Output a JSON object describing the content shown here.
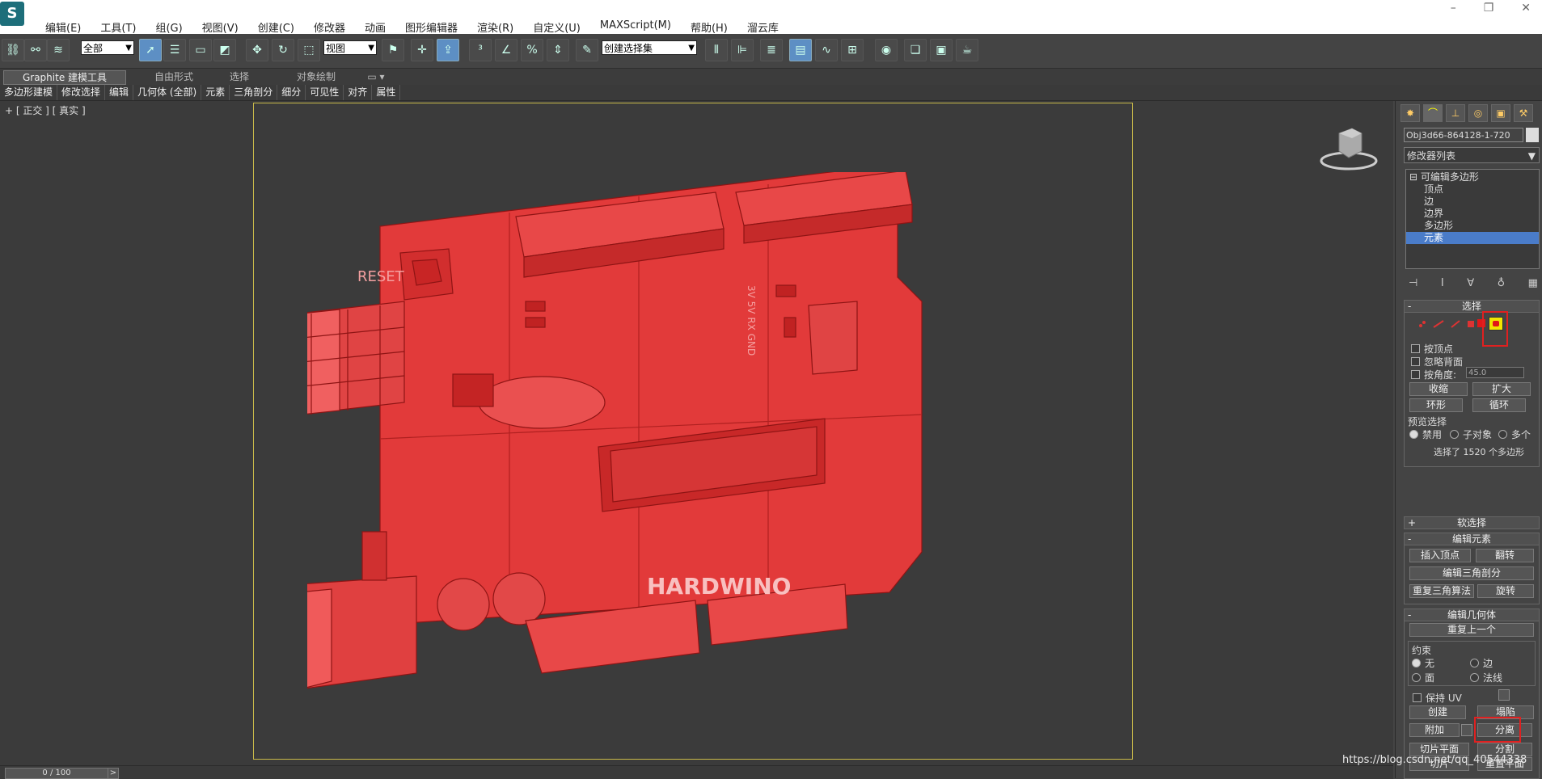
{
  "menubar": {
    "logo": "S",
    "items": [
      "编辑(E)",
      "工具(T)",
      "组(G)",
      "视图(V)",
      "创建(C)",
      "修改器",
      "动画",
      "图形编辑器",
      "渲染(R)",
      "自定义(U)",
      "MAXScript(M)",
      "帮助(H)",
      "溜云库"
    ],
    "window_controls": [
      "–",
      "❐",
      "✕"
    ]
  },
  "toolbar": {
    "selection_filter": "全部",
    "ref_coord": "视图",
    "named_selection": "创建选择集"
  },
  "ribbon": {
    "tabs": [
      "Graphite 建模工具",
      "自由形式",
      "选择",
      "对象绘制"
    ],
    "items": [
      "多边形建模",
      "修改选择",
      "编辑",
      "几何体 (全部)",
      "元素",
      "三角剖分",
      "细分",
      "可见性",
      "对齐",
      "属性"
    ]
  },
  "viewport": {
    "label": "+ [ 正交 ] [ 真实 ]",
    "board_text_reset": "RESET",
    "board_text_brand": "HARDWINO",
    "board_text_pins": "3V 5V RX GND"
  },
  "command_panel": {
    "object_name": "Obj3d66-864128-1-720",
    "modifier_list": "修改器列表",
    "stack": [
      "可编辑多边形",
      "顶点",
      "边",
      "边界",
      "多边形",
      "元素"
    ],
    "select_rollout": {
      "title": "选择",
      "by_vertex": "按顶点",
      "ignore_backfacing": "忽略背面",
      "by_angle": "按角度:",
      "angle_value": "45.0",
      "shrink": "收缩",
      "grow": "扩大",
      "ring": "环形",
      "loop": "循环",
      "preview_title": "预览选择",
      "preview_options": [
        "禁用",
        "子对象",
        "多个"
      ],
      "status": "选择了 1520 个多边形"
    },
    "soft_select_title": "软选择",
    "edit_element": {
      "title": "编辑元素",
      "insert_vertex": "插入顶点",
      "flip": "翻转",
      "edit_triangulation": "编辑三角剖分",
      "retriangulate": "重复三角算法",
      "turn": "旋转"
    },
    "edit_geometry": {
      "title": "编辑几何体",
      "repeat_last": "重复上一个",
      "constraints_title": "约束",
      "constraints": [
        "无",
        "边",
        "面",
        "法线"
      ],
      "preserve_uv": "保持 UV",
      "create": "创建",
      "collapse": "塌陷",
      "attach": "附加",
      "detach": "分离",
      "slice_plane": "切片平面",
      "split": "分割",
      "slice": "切片",
      "reset_plane": "重置平面"
    }
  },
  "status": {
    "frame": "0 / 100",
    "arrow": ">"
  },
  "watermark": "https://blog.csdn.net/qq_40544338"
}
